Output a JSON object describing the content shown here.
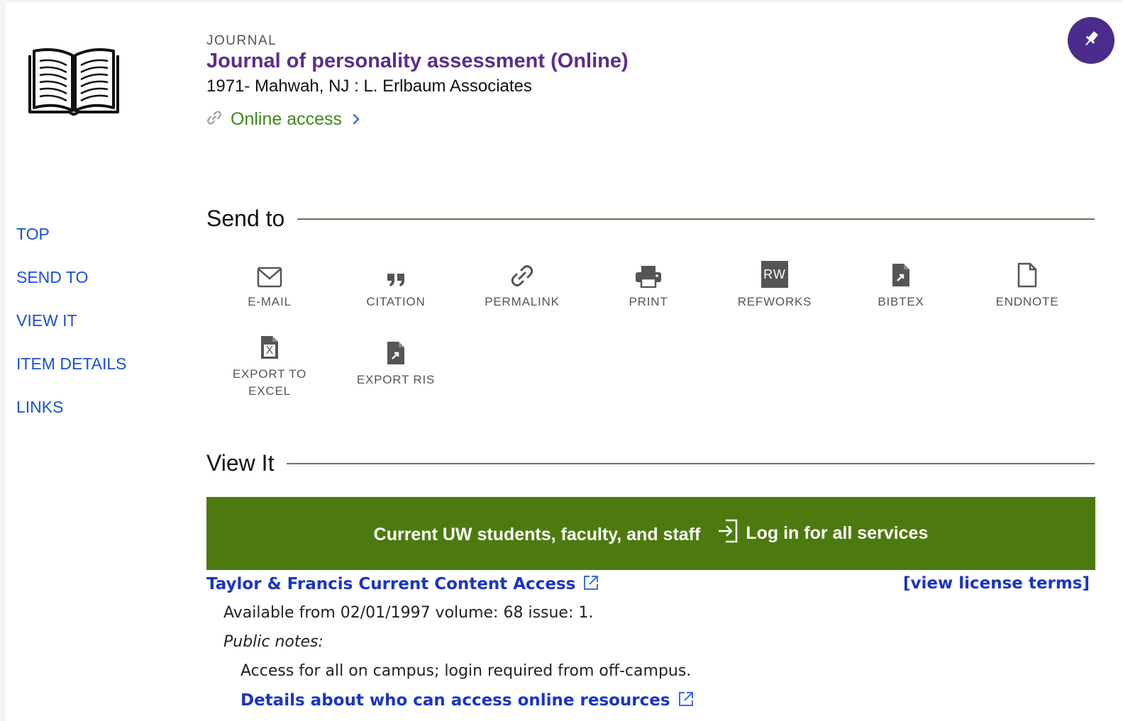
{
  "record": {
    "type": "JOURNAL",
    "title": "Journal of personality assessment (Online)",
    "publication": "1971- Mahwah, NJ : L. Erlbaum Associates",
    "online_access": "Online access"
  },
  "side_nav": {
    "items": [
      {
        "label": "TOP"
      },
      {
        "label": "SEND TO"
      },
      {
        "label": "VIEW IT"
      },
      {
        "label": "ITEM DETAILS"
      },
      {
        "label": "LINKS"
      }
    ]
  },
  "send_to": {
    "heading": "Send to",
    "actions": [
      {
        "label": "E-MAIL",
        "icon": "envelope-icon"
      },
      {
        "label": "CITATION",
        "icon": "quote-icon"
      },
      {
        "label": "PERMALINK",
        "icon": "link-icon"
      },
      {
        "label": "PRINT",
        "icon": "printer-icon"
      },
      {
        "label": "REFWORKS",
        "icon": "refworks-icon",
        "icon_text": "RW"
      },
      {
        "label": "BIBTEX",
        "icon": "bibtex-file-icon"
      },
      {
        "label": "ENDNOTE",
        "icon": "document-icon"
      },
      {
        "label": "EXPORT TO EXCEL",
        "icon": "excel-file-icon",
        "icon_text": "X"
      },
      {
        "label": "EXPORT RIS",
        "icon": "ris-file-icon"
      }
    ]
  },
  "view_it": {
    "heading": "View It",
    "login_banner": {
      "who": "Current UW students, faculty, and staff",
      "login_label": "Log in for all services"
    },
    "provider": "Taylor & Francis Current Content Access",
    "license_link": "[view license terms]",
    "availability": "Available from 02/01/1997 volume: 68 issue: 1.",
    "public_notes_label": "Public notes:",
    "public_notes": "Access for all on campus; login required from off-campus.",
    "details_link": "Details about who can access online resources"
  },
  "colors": {
    "title": "#5a2d8c",
    "online_access": "#3c8a1a",
    "nav_link": "#1a4fd6",
    "banner": "#4d7a0f",
    "pin_button": "#4b2c8c",
    "provider_link": "#1a35c2"
  }
}
